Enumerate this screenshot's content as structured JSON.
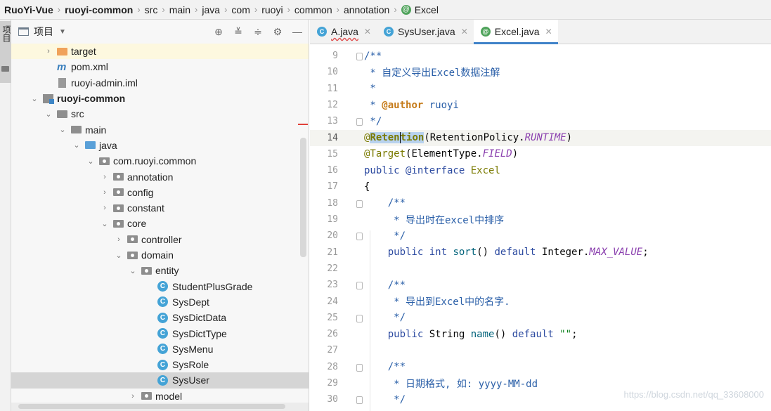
{
  "breadcrumb": [
    "RuoYi-Vue",
    "ruoyi-common",
    "src",
    "main",
    "java",
    "com",
    "ruoyi",
    "common",
    "annotation",
    "Excel"
  ],
  "toolstrip": {
    "tab_label": "项目"
  },
  "project_panel": {
    "title": "项目",
    "tools": [
      "crosshair-icon",
      "expand-all-icon",
      "collapse-all-icon",
      "gear-icon",
      "minimize-icon"
    ],
    "tree": [
      {
        "label": "target",
        "icon": "folder-orange-icon",
        "arrow": "right"
      },
      {
        "label": "pom.xml",
        "icon": "maven-icon",
        "arrow": ""
      },
      {
        "label": "ruoyi-admin.iml",
        "icon": "iml-file-icon",
        "arrow": ""
      },
      {
        "label": "ruoyi-common",
        "icon": "module-icon",
        "arrow": "down"
      },
      {
        "label": "src",
        "icon": "folder-icon",
        "arrow": "down"
      },
      {
        "label": "main",
        "icon": "folder-icon",
        "arrow": "down"
      },
      {
        "label": "java",
        "icon": "folder-blue-icon",
        "arrow": "down"
      },
      {
        "label": "com.ruoyi.common",
        "icon": "package-icon",
        "arrow": "down"
      },
      {
        "label": "annotation",
        "icon": "package-icon",
        "arrow": "right"
      },
      {
        "label": "config",
        "icon": "package-icon",
        "arrow": "right"
      },
      {
        "label": "constant",
        "icon": "package-icon",
        "arrow": "right"
      },
      {
        "label": "core",
        "icon": "package-icon",
        "arrow": "down"
      },
      {
        "label": "controller",
        "icon": "package-icon",
        "arrow": "right"
      },
      {
        "label": "domain",
        "icon": "package-icon",
        "arrow": "down"
      },
      {
        "label": "entity",
        "icon": "package-icon",
        "arrow": "down"
      },
      {
        "label": "StudentPlusGrade",
        "icon": "class-icon",
        "arrow": ""
      },
      {
        "label": "SysDept",
        "icon": "class-icon",
        "arrow": ""
      },
      {
        "label": "SysDictData",
        "icon": "class-icon",
        "arrow": ""
      },
      {
        "label": "SysDictType",
        "icon": "class-icon",
        "arrow": ""
      },
      {
        "label": "SysMenu",
        "icon": "class-icon",
        "arrow": ""
      },
      {
        "label": "SysRole",
        "icon": "class-icon",
        "arrow": ""
      },
      {
        "label": "SysUser",
        "icon": "class-icon",
        "arrow": ""
      },
      {
        "label": "model",
        "icon": "package-icon",
        "arrow": "right"
      }
    ],
    "selected": "SysUser",
    "highlighted": "target"
  },
  "editor": {
    "tabs": [
      {
        "label": "A.java",
        "icon": "C",
        "error": true,
        "active": false
      },
      {
        "label": "SysUser.java",
        "icon": "C",
        "error": false,
        "active": false
      },
      {
        "label": "Excel.java",
        "icon": "@",
        "error": false,
        "active": true
      }
    ],
    "line_numbers": [
      "9",
      "10",
      "11",
      "12",
      "13",
      "14",
      "15",
      "16",
      "17",
      "18",
      "19",
      "20",
      "21",
      "22",
      "23",
      "24",
      "25",
      "26",
      "27",
      "28",
      "29",
      "30"
    ],
    "current_line": "14",
    "code": {
      "l9": "/**",
      "l10": " * 自定义导出Excel数据注解",
      "l11": " *",
      "l12_pre": " * ",
      "l12_tag": "@author",
      "l12_post": " ruoyi",
      "l13": " */",
      "l14_at": "@",
      "l14_word_a": "Reten",
      "l14_word_b": "tion",
      "l14_mid": "(RetentionPolicy.",
      "l14_const": "RUNTIME",
      "l14_end": ")",
      "l15_anno": "@Target",
      "l15_mid": "(ElementType.",
      "l15_const": "FIELD",
      "l15_end": ")",
      "l16_kw": "public @interface",
      "l16_name": " Excel",
      "l17": "{",
      "l18": "    /**",
      "l19": "     * 导出时在excel中排序",
      "l20": "     */",
      "l21_kw1": "    public ",
      "l21_kw2": "int",
      "l21_fn": " sort",
      "l21_mid": "() ",
      "l21_kw3": "default",
      "l21_type": " Integer.",
      "l21_const": "MAX_VALUE",
      "l21_end": ";",
      "l23": "    /**",
      "l24": "     * 导出到Excel中的名字.",
      "l25": "     */",
      "l26_kw1": "    public",
      "l26_type": " String ",
      "l26_fn": "name",
      "l26_mid": "() ",
      "l26_kw2": "default",
      "l26_str": " \"\"",
      "l26_end": ";",
      "l28": "    /**",
      "l29": "     * 日期格式, 如: yyyy-MM-dd",
      "l30": "     */"
    }
  },
  "watermark": "https://blog.csdn.net/qq_33608000"
}
